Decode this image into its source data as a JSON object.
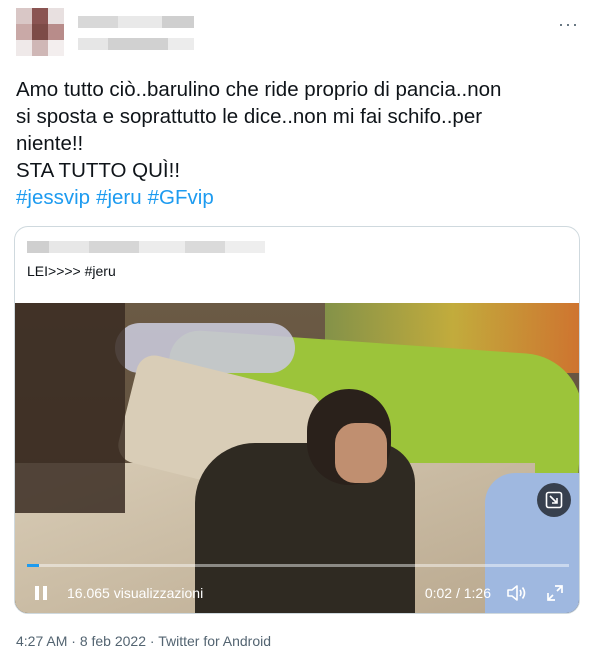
{
  "tweet": {
    "author_blurred": true,
    "more_label": "···",
    "text_line1": "Amo tutto ciò..barulino che ride proprio di pancia..non",
    "text_line2": "si sposta e soprattutto le dice..non mi fai schifo..per",
    "text_line3": "niente!!",
    "text_line4": "STA TUTTO QUÌ!!",
    "hashtags": [
      "#jessvip",
      "#jeru",
      "#GFvip"
    ]
  },
  "quoted": {
    "author_blurred": true,
    "text": "LEI>>>> #jeru",
    "video": {
      "views": "16.065 visualizzazioni",
      "time": "0:02 / 1:26",
      "progress": 0.023
    }
  },
  "meta": {
    "time": "4:27 AM",
    "sep1": " · ",
    "date": "8 feb 2022",
    "sep2": " · ",
    "source": "Twitter for Android"
  },
  "colors": {
    "accent": "#1d9bf0",
    "text": "#0f1419",
    "muted": "#536471",
    "border": "#cfd9de"
  }
}
